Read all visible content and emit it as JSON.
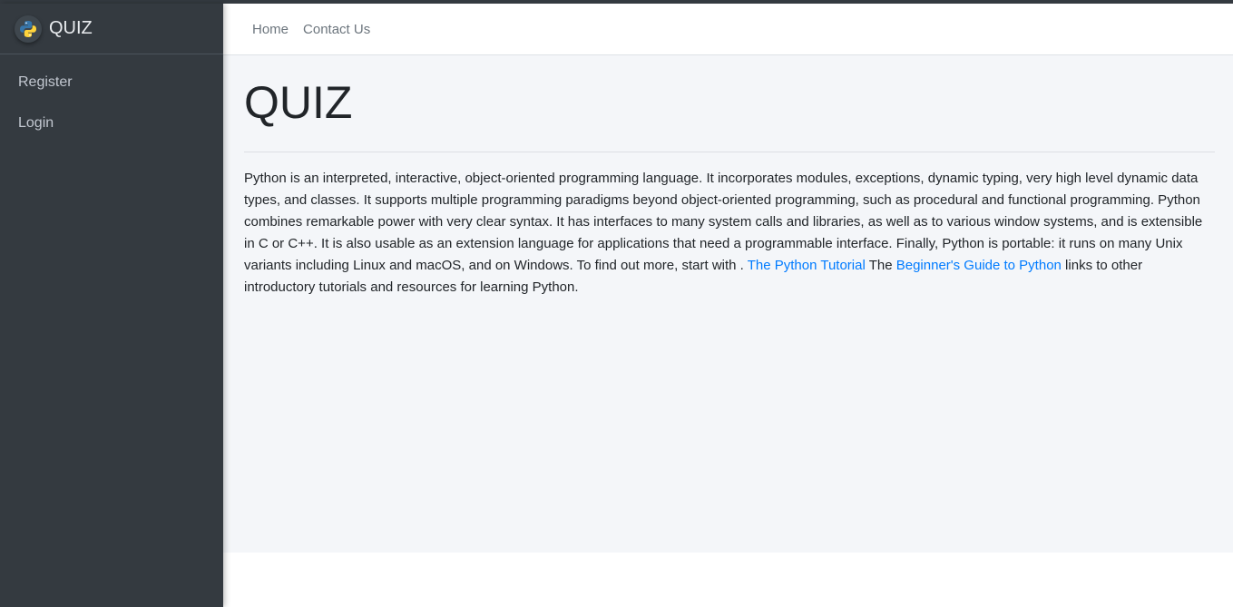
{
  "brand": {
    "title": "QUIZ",
    "logo_icon": "python-logo-icon"
  },
  "sidebar": {
    "items": [
      {
        "label": "Register"
      },
      {
        "label": "Login"
      }
    ]
  },
  "header": {
    "links": [
      {
        "label": "Home"
      },
      {
        "label": "Contact Us"
      }
    ]
  },
  "main": {
    "title": "QUIZ",
    "paragraph_part1": "Python is an interpreted, interactive, object-oriented programming language. It incorporates modules, exceptions, dynamic typing, very high level dynamic data types, and classes. It supports multiple programming paradigms beyond object-oriented programming, such as procedural and functional programming. Python combines remarkable power with very clear syntax. It has interfaces to many system calls and libraries, as well as to various window systems, and is extensible in C or C++. It is also usable as an extension language for applications that need a programmable interface. Finally, Python is portable: it runs on many Unix variants including Linux and macOS, and on Windows. To find out more, start with . ",
    "link1": "The Python Tutorial",
    "paragraph_part2": " The ",
    "link2": "Beginner's Guide to Python",
    "paragraph_part3": " links to other introductory tutorials and resources for learning Python."
  },
  "colors": {
    "sidebar_bg": "#343a40",
    "content_bg": "#f4f6f9",
    "link": "#007bff"
  }
}
